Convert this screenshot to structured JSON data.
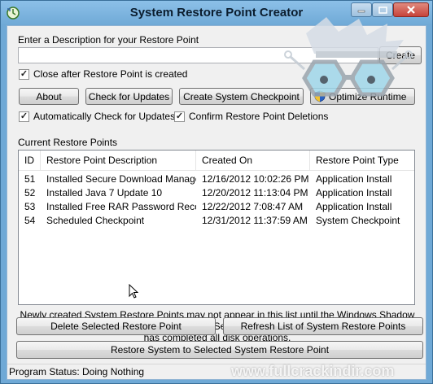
{
  "window": {
    "title": "System Restore Point Creator",
    "minimize_icon": "minimize-icon",
    "maximize_icon": "maximize-icon",
    "close_icon": "close-icon"
  },
  "description": {
    "label": "Enter a Description for your Restore Point",
    "value": "",
    "create_label": "Create"
  },
  "options": {
    "close_after": {
      "label": "Close after Restore Point is created",
      "checked": true
    },
    "auto_check": {
      "label": "Automatically Check for Updates",
      "checked": true
    },
    "confirm_delete": {
      "label": "Confirm Restore Point Deletions",
      "checked": true
    }
  },
  "toolbar": {
    "about": "About",
    "check_updates": "Check for Updates",
    "create_checkpoint": "Create System Checkpoint",
    "optimize": "Optimize Runtime",
    "optimize_icon": "shield-icon"
  },
  "restore_points": {
    "label": "Current Restore Points",
    "columns": [
      "ID",
      "Restore Point Description",
      "Created On",
      "Restore Point Type"
    ],
    "rows": [
      [
        "51",
        "Installed Secure Download Manager",
        "12/16/2012 10:02:26 PM",
        "Application Install"
      ],
      [
        "52",
        "Installed Java 7 Update 10",
        "12/20/2012 11:13:04 PM",
        "Application Install"
      ],
      [
        "53",
        "Installed Free RAR Password Reco...",
        "12/22/2012 7:08:47 AM",
        "Application Install"
      ],
      [
        "54",
        "Scheduled Checkpoint",
        "12/31/2012 11:37:59 AM",
        "System Checkpoint"
      ]
    ]
  },
  "notice": {
    "line1": "Newly created System Restore Points may not appear in this list until the Windows Shadow Copy Service",
    "line2": "has completed all disk operations."
  },
  "actions": {
    "delete": "Delete Selected Restore Point",
    "refresh": "Refresh List of System Restore Points",
    "restore": "Restore System to Selected System Restore Point"
  },
  "status": {
    "label": "Program Status:",
    "value": "Doing Nothing"
  },
  "watermark": "www.fullcrackindir.com",
  "colors": {
    "titlebar": "#6fa9d6",
    "client": "#f0f0f0"
  }
}
